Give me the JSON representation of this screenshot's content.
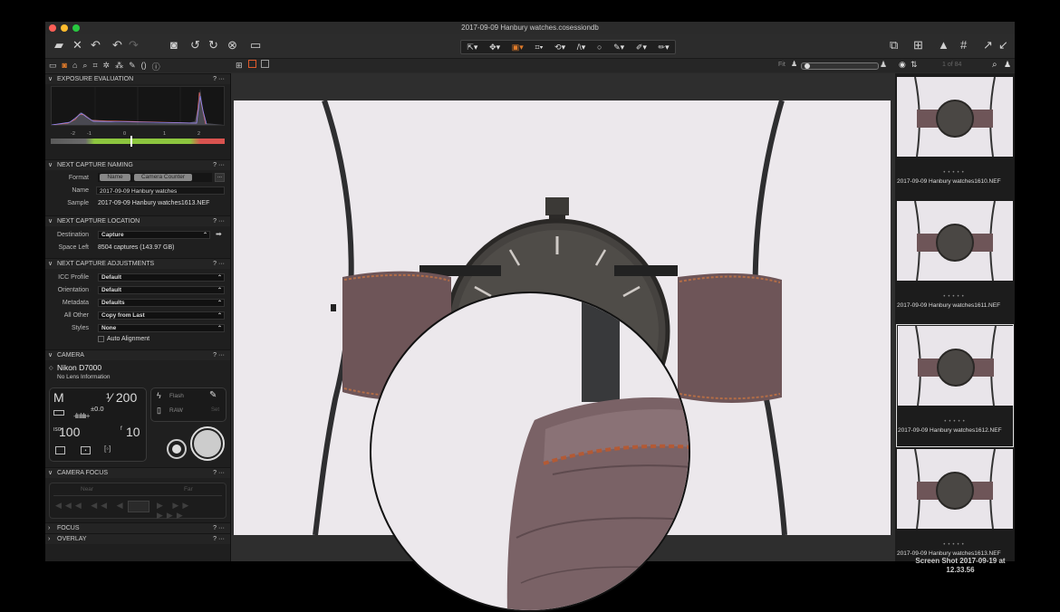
{
  "window": {
    "title": "2017-09-09 Hanbury watches.cosessiondb",
    "traffic_lights": [
      "#fe5f57",
      "#febc2e",
      "#28c840"
    ]
  },
  "accent_color": "#e07b2a",
  "toolbar": {
    "left_icons": [
      "import-icon",
      "delete-icon",
      "undo-all-icon",
      "undo-icon",
      "redo-icon",
      "capture-icon",
      "rotate-left-icon",
      "rotate-right-icon",
      "reset-icon",
      "live-view-icon"
    ],
    "cursor_tools": [
      "select-tool",
      "pan-tool",
      "loupe-tool",
      "crop-tool",
      "rotate-tool",
      "keystone-tool",
      "spot-tool",
      "draw-mask-tool",
      "erase-mask-tool",
      "fill-mask-tool"
    ],
    "right_icons": [
      "copy-apply-icon",
      "grid-icon",
      "warning-icon",
      "grid-overlay-icon",
      "expand-icon"
    ]
  },
  "viewer_bar": {
    "fit_label": "Fit",
    "counter": "1 of 84"
  },
  "sections": {
    "exposure": {
      "title": "EXPOSURE EVALUATION",
      "help": "?",
      "more": "···",
      "scale": [
        "-2",
        "-1",
        "0",
        "1",
        "2"
      ]
    },
    "naming": {
      "title": "NEXT CAPTURE NAMING",
      "format_label": "Format",
      "format_tokens": [
        "Name",
        "Camera Counter"
      ],
      "more_button": "...",
      "name_label": "Name",
      "name_value": "2017-09-09 Hanbury watches",
      "sample_label": "Sample",
      "sample_value": "2017-09-09 Hanbury watches1613.NEF"
    },
    "location": {
      "title": "NEXT CAPTURE LOCATION",
      "destination_label": "Destination",
      "destination_value": "Capture",
      "space_label": "Space Left",
      "space_value": "8504 captures (143.97 GB)"
    },
    "adjustments": {
      "title": "NEXT CAPTURE ADJUSTMENTS",
      "rows": [
        {
          "label": "ICC Profile",
          "value": "Default"
        },
        {
          "label": "Orientation",
          "value": "Default"
        },
        {
          "label": "Metadata",
          "value": "Defaults"
        },
        {
          "label": "All Other",
          "value": "Copy from Last"
        },
        {
          "label": "Styles",
          "value": "None"
        }
      ],
      "auto_alignment": "Auto Alignment"
    },
    "camera": {
      "title": "CAMERA",
      "model": "Nikon D7000",
      "lens": "No Lens Information",
      "mode": "M",
      "shutter": "¹⁄ 200",
      "exposure_comp": "±0.0",
      "iso": "100",
      "iso_prefix": "ISO",
      "aperture": "10",
      "aperture_prefix": "f",
      "flash_label": "Flash",
      "raw_label": "RAW",
      "set_label": "Set"
    },
    "focus": {
      "title": "CAMERA FOCUS",
      "near": "Near",
      "far": "Far"
    },
    "focus2": {
      "title": "FOCUS"
    },
    "overlay": {
      "title": "OVERLAY"
    }
  },
  "thumbnails": [
    {
      "filename": "2017-09-09 Hanbury watches1610.NEF",
      "selected": false
    },
    {
      "filename": "2017-09-09 Hanbury watches1611.NEF",
      "selected": false
    },
    {
      "filename": "2017-09-09 Hanbury watches1612.NEF",
      "selected": true
    },
    {
      "filename": "2017-09-09 Hanbury watches1613.NEF",
      "selected": false
    }
  ],
  "screenshot_label": {
    "line1": "Screen Shot 2017-09-19 at",
    "line2": "12.33.56"
  }
}
